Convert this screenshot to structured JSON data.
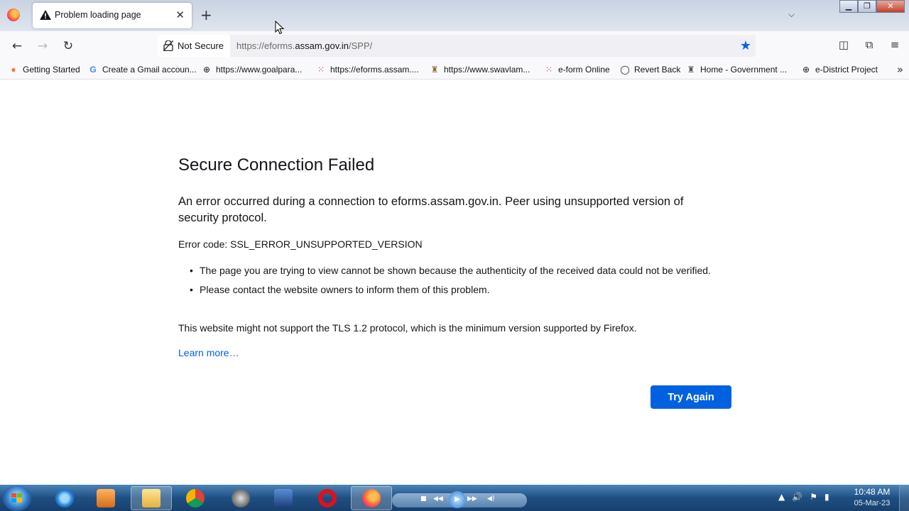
{
  "browser": {
    "tab": {
      "title": "Problem loading page",
      "close": "✕"
    },
    "new_tab": "+",
    "tab_list": "⌵",
    "window_controls": {
      "minimize": "▁",
      "maximize": "❐",
      "close": "✕"
    },
    "nav": {
      "back": "←",
      "forward": "→",
      "reload": "↻"
    },
    "urlbar": {
      "security_label": "Not Secure",
      "url_prefix": "https://eforms.",
      "url_host": "assam.gov.in",
      "url_path": "/SPP/",
      "star": "★"
    },
    "tools": {
      "pocket": "◫",
      "extensions": "⧉",
      "menu": "≡"
    }
  },
  "bookmarks": [
    {
      "label": "Getting Started",
      "icon": "firefox-icon",
      "glyph": "●",
      "color": "#ff7139"
    },
    {
      "label": "Create a Gmail accoun...",
      "icon": "google-icon",
      "glyph": "G",
      "color": "#4285f4"
    },
    {
      "label": "https://www.goalpara...",
      "icon": "globe-icon",
      "glyph": "⊕",
      "color": "#333333"
    },
    {
      "label": "https://eforms.assam....",
      "icon": "spinner-icon",
      "glyph": "⁙",
      "color": "#d0342c"
    },
    {
      "label": "https://www.swavlam...",
      "icon": "emblem-icon",
      "glyph": "♜",
      "color": "#8a6d3b"
    },
    {
      "label": "e-form Online",
      "icon": "spinner-icon",
      "glyph": "⁙",
      "color": "#d0342c"
    },
    {
      "label": "Revert Back",
      "icon": "circle-icon",
      "glyph": "◯",
      "color": "#333333"
    },
    {
      "label": "Home - Government ...",
      "icon": "emblem-icon",
      "glyph": "♜",
      "color": "#555555"
    },
    {
      "label": "e-District Project",
      "icon": "globe-icon",
      "glyph": "⊕",
      "color": "#333333"
    }
  ],
  "bookmarks_more": "»",
  "error_page": {
    "title": "Secure Connection Failed",
    "description": "An error occurred during a connection to eforms.assam.gov.in. Peer using unsupported version of security protocol.",
    "error_code": "Error code: SSL_ERROR_UNSUPPORTED_VERSION",
    "bullets": [
      "The page you are trying to view cannot be shown because the authenticity of the received data could not be verified.",
      "Please contact the website owners to inform them of this problem."
    ],
    "tls_note": "This website might not support the TLS 1.2 protocol, which is the minimum version supported by Firefox.",
    "learn_more": "Learn more…",
    "try_again": "Try Again"
  },
  "taskbar": {
    "media": {
      "prev": "◀◀",
      "next": "▶▶",
      "play": "▶",
      "stop": "■",
      "vol": "◀)"
    },
    "tray": {
      "up": "▲",
      "volume": "🔊",
      "flag": "⚑",
      "network": "▮"
    },
    "clock": {
      "time": "10:48 AM",
      "date": "05-Mar-23"
    }
  },
  "colors": {
    "accent": "#0061e0",
    "star": "#0b62e3"
  }
}
